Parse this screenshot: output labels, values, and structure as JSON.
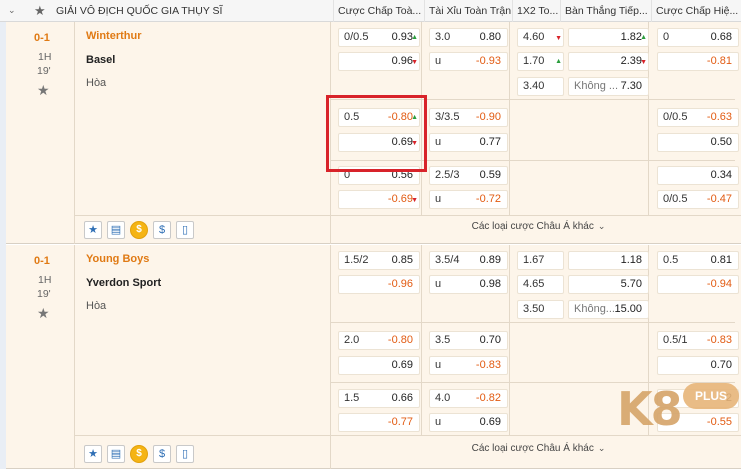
{
  "header": {
    "league": "GIẢI VÔ ĐỊCH QUỐC GIA THỤY SĨ",
    "columns": [
      "Cược Chấp Toà...",
      "Tài Xỉu Toàn Trận",
      "1X2 To...",
      "Bàn Thắng Tiếp...",
      "Cược Chấp Hiệ..."
    ]
  },
  "more_label": "Các loại cược Châu Á khác",
  "matches": [
    {
      "score": "0-1",
      "half": "1H",
      "minute": "19'",
      "home": "Winterthur",
      "away": "Basel",
      "draw": "Hòa",
      "rows": [
        {
          "hdp_line": "0/0.5",
          "hdp_home": "0.93",
          "hdp_away": "0.96",
          "ou_line": "3.0",
          "ou_over": "0.80",
          "ou_under_label": "u",
          "ou_under": "-0.93",
          "x12_1": "4.60",
          "x12_2": "1.70",
          "x12_x": "3.40",
          "ng_1": "1.82",
          "ng_2": "2.39",
          "ng_label": "Không ...",
          "ng_none": "7.30",
          "h1_line": "0",
          "h1_home": "0.68",
          "h1_away": "-0.81"
        },
        {
          "hdp_line": "0.5",
          "hdp_home": "-0.80",
          "hdp_away": "0.69",
          "ou_line": "3/3.5",
          "ou_over": "-0.90",
          "ou_under_label": "u",
          "ou_under": "0.77",
          "h1_line": "0/0.5",
          "h1_home": "-0.63",
          "h1_away": "0.50"
        },
        {
          "hdp_line": "0",
          "hdp_home": "0.56",
          "hdp_away": "-0.69",
          "ou_line": "2.5/3",
          "ou_over": "0.59",
          "ou_under_label": "u",
          "ou_under": "-0.72",
          "h1_home": "0.34",
          "h1_line2": "0/0.5",
          "h1_away": "-0.47"
        }
      ]
    },
    {
      "score": "0-1",
      "half": "1H",
      "minute": "19'",
      "home": "Young Boys",
      "away": "Yverdon Sport",
      "draw": "Hòa",
      "rows": [
        {
          "hdp_line": "1.5/2",
          "hdp_home": "0.85",
          "hdp_away": "-0.96",
          "ou_line": "3.5/4",
          "ou_over": "0.89",
          "ou_under_label": "u",
          "ou_under": "0.98",
          "x12_1": "1.67",
          "x12_2": "4.65",
          "x12_x": "3.50",
          "ng_1": "1.18",
          "ng_2": "5.70",
          "ng_label": "Không...",
          "ng_none": "15.00",
          "h1_line": "0.5",
          "h1_home": "0.81",
          "h1_away": "-0.94"
        },
        {
          "hdp_line": "2.0",
          "hdp_home": "-0.80",
          "hdp_away": "0.69",
          "ou_line": "3.5",
          "ou_over": "0.70",
          "ou_under_label": "u",
          "ou_under": "-0.83",
          "h1_line": "0.5/1",
          "h1_home": "-0.83",
          "h1_away": "0.70"
        },
        {
          "hdp_line": "1.5",
          "hdp_home": "0.66",
          "hdp_away": "-0.77",
          "ou_line": "4.0",
          "ou_over": "-0.82",
          "ou_under_label": "u",
          "ou_under": "0.69",
          "h1_home": "2",
          "h1_away": "-0.55"
        }
      ]
    }
  ],
  "logo": {
    "brand": "K8",
    "badge": "PLUS"
  },
  "colors": {
    "accent": "#e07a14",
    "negative": "#e25b12",
    "up": "#2a9d3c",
    "down": "#d8232a",
    "highlight": "#d8232a"
  }
}
